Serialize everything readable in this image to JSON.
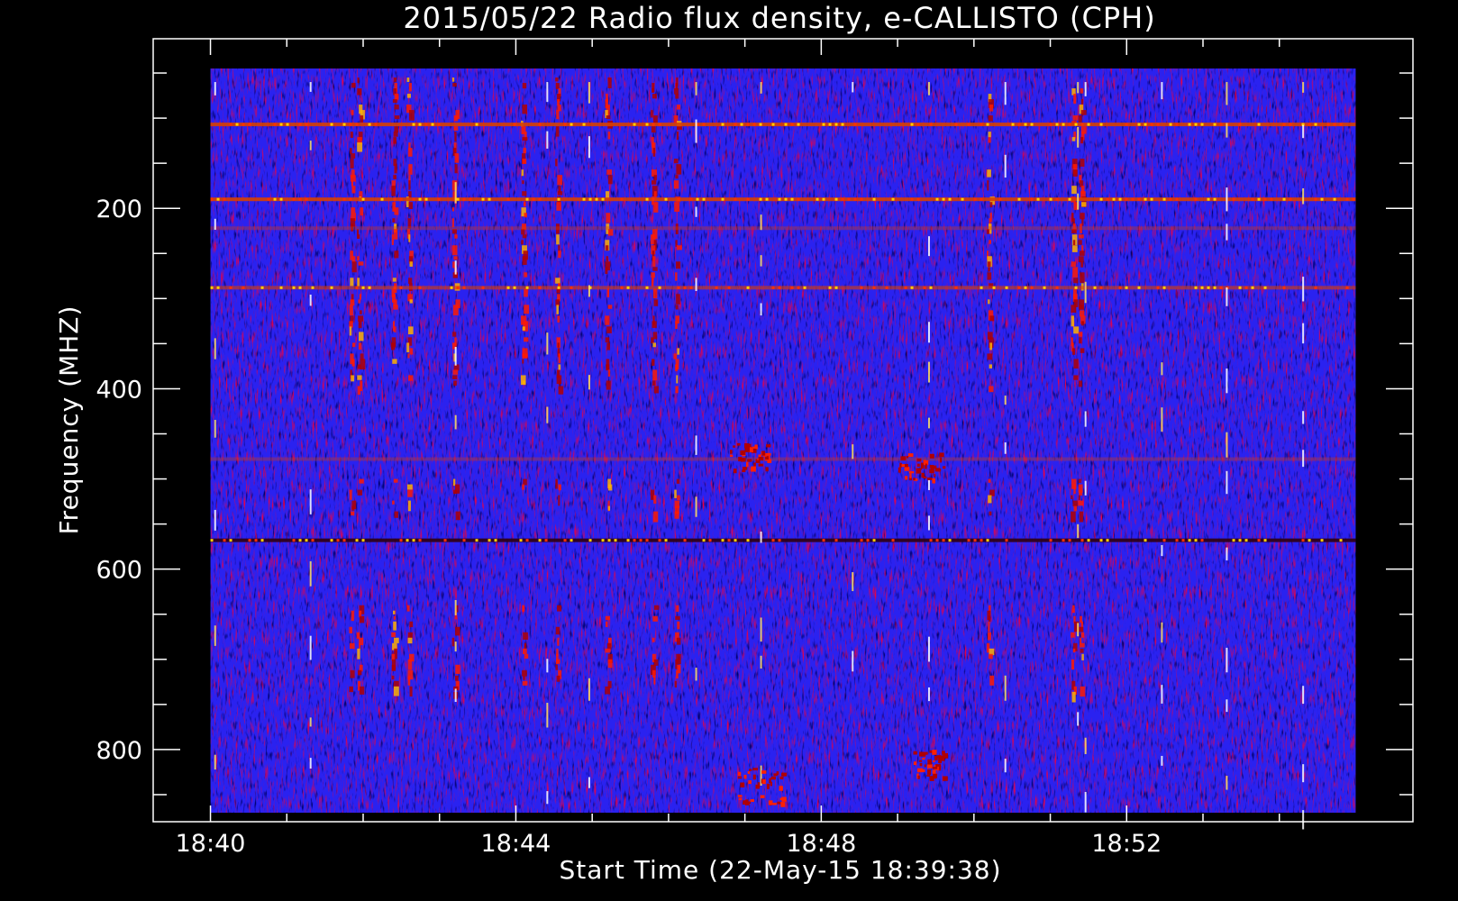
{
  "chart_data": {
    "type": "heatmap",
    "title": "2015/05/22  Radio flux density, e-CALLISTO (CPH)",
    "xlabel": "Start Time (22-May-15 18:39:38)",
    "ylabel": "Frequency (MHZ)",
    "x_tick_labels": [
      "18:40",
      "18:44",
      "18:48",
      "18:52"
    ],
    "x_ticks_min": [
      40,
      44,
      48,
      52
    ],
    "x_minor_ticks_min": [
      41,
      42,
      43,
      45,
      46,
      47,
      49,
      50,
      51,
      53,
      54
    ],
    "xlim_min": [
      39.25,
      55.75
    ],
    "y_tick_labels": [
      "200",
      "400",
      "600",
      "800"
    ],
    "y_ticks_mhz": [
      200,
      400,
      600,
      800
    ],
    "y_minor_ticks_mhz": [
      50,
      100,
      150,
      250,
      300,
      350,
      450,
      500,
      550,
      650,
      700,
      750,
      850
    ],
    "ylim_mhz": [
      880,
      12
    ],
    "data_extent": {
      "time_min": [
        40,
        55
      ],
      "freq_mhz": [
        45,
        870
      ]
    },
    "y_inverted": true,
    "colormap": [
      "#000000",
      "#0000ff",
      "#c80000",
      "#ff0000",
      "#ffd000",
      "#ffffff"
    ],
    "background_color": "#2a22f0",
    "horizontal_interference_bands_mhz": [
      {
        "freq": 107,
        "intensity": "high"
      },
      {
        "freq": 190,
        "intensity": "high"
      },
      {
        "freq": 222,
        "intensity": "low"
      },
      {
        "freq": 288,
        "intensity": "medium"
      },
      {
        "freq": 478,
        "intensity": "low"
      },
      {
        "freq": 568,
        "intensity": "high"
      }
    ],
    "burst_columns_min": [
      41.85,
      41.95,
      42.4,
      42.6,
      43.2,
      44.1,
      44.55,
      45.2,
      45.8,
      46.1,
      50.2,
      51.3,
      51.4
    ],
    "vertical_spikes_min": [
      40.05,
      41.3,
      43.2,
      44.4,
      44.95,
      46.35,
      47.2,
      48.4,
      49.4,
      50.4,
      51.35,
      51.45,
      52.45,
      53.3,
      54.3
    ],
    "diffuse_patches": [
      {
        "time": [
          46.8,
          47.3
        ],
        "freq": [
          460,
          490
        ]
      },
      {
        "time": [
          49.2,
          49.6
        ],
        "freq": [
          800,
          830
        ]
      },
      {
        "time": [
          46.9,
          47.5
        ],
        "freq": [
          820,
          860
        ]
      },
      {
        "time": [
          49.0,
          49.6
        ],
        "freq": [
          470,
          500
        ]
      }
    ],
    "grid": false,
    "legend": "none"
  }
}
